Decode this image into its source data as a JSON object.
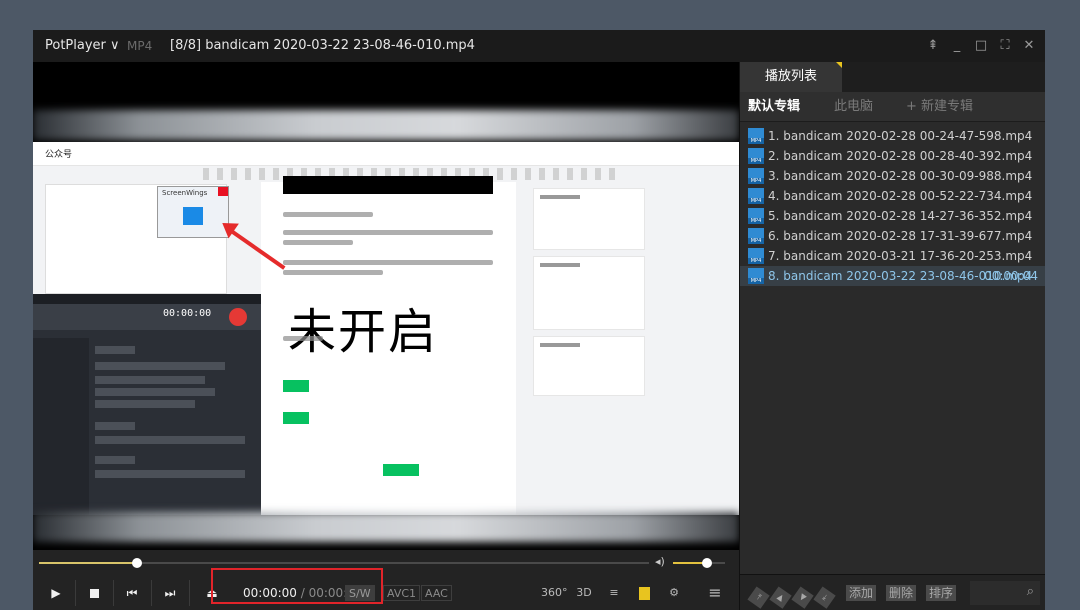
{
  "titlebar": {
    "app": "PotPlayer ∨",
    "format": "MP4",
    "title": "[8/8] bandicam 2020-03-22 23-08-46-010.mp4"
  },
  "video_frame": {
    "editor_heading": "未开启",
    "header_logo": "公众号",
    "popup_title": "ScreenWings"
  },
  "controls": {
    "position": "00:00:00",
    "separator": "/",
    "duration": "00:00:04",
    "sw": "S/W",
    "video_codec": "AVC1",
    "audio_codec": "AAC",
    "seek_fraction": 0.16,
    "volume_fraction": 0.65
  },
  "panel": {
    "tab_playlist": "播放列表",
    "tab_default": "默认专辑",
    "tab_this_pc": "此电脑",
    "tab_new": "+ 新建专辑",
    "items": [
      {
        "label": "1. bandicam 2020-02-28 00-24-47-598.mp4",
        "duration": ""
      },
      {
        "label": "2. bandicam 2020-02-28 00-28-40-392.mp4",
        "duration": ""
      },
      {
        "label": "3. bandicam 2020-02-28 00-30-09-988.mp4",
        "duration": ""
      },
      {
        "label": "4. bandicam 2020-02-28 00-52-22-734.mp4",
        "duration": ""
      },
      {
        "label": "5. bandicam 2020-02-28 14-27-36-352.mp4",
        "duration": ""
      },
      {
        "label": "6. bandicam 2020-02-28 17-31-39-677.mp4",
        "duration": ""
      },
      {
        "label": "7. bandicam 2020-03-21 17-36-20-253.mp4",
        "duration": ""
      },
      {
        "label": "8. bandicam 2020-03-22 23-08-46-010.mp4",
        "duration": "00:00:04"
      }
    ],
    "footer": {
      "add": "添加",
      "delete": "删除",
      "sort": "排序"
    }
  },
  "colors": {
    "accent": "#e8c41f",
    "highlight_box": "#e1242a",
    "current_item": "#8fc6ea"
  }
}
